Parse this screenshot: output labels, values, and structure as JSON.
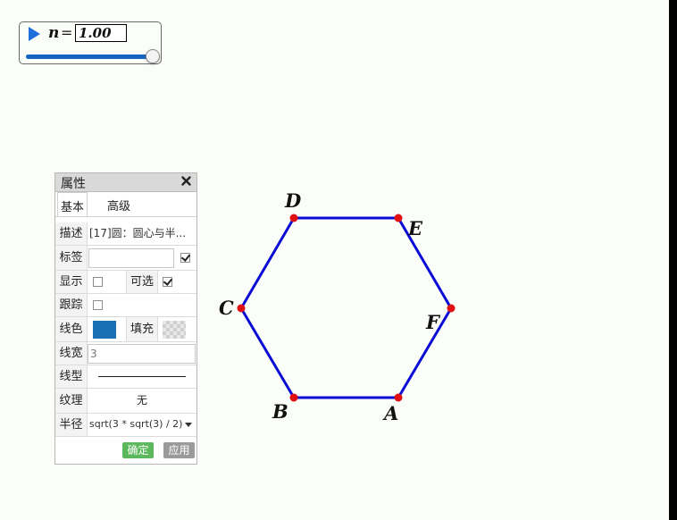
{
  "slider": {
    "var_name": "n",
    "equals": "=",
    "value": "1.00",
    "progress": 1.0,
    "track_color": "#1565c0"
  },
  "panel": {
    "title": "属性",
    "tabs": [
      "基本",
      "高级"
    ],
    "rows": {
      "description": {
        "label": "描述",
        "value": "[17]圆：圆心与半..."
      },
      "caption": {
        "label": "标签",
        "value": "",
        "checked": true
      },
      "show": {
        "label": "显示",
        "checked": false,
        "selectable_label": "可选",
        "selectable_checked": true
      },
      "trace": {
        "label": "跟踪",
        "checked": false
      },
      "color": {
        "label": "线色",
        "swatch": "#1a6fb5",
        "fill_label": "填充"
      },
      "width": {
        "label": "线宽",
        "value": "3"
      },
      "style": {
        "label": "线型"
      },
      "texture": {
        "label": "纹理",
        "value": "无"
      },
      "radius": {
        "label": "半径",
        "value": "sqrt(3 * sqrt(3) / 2)"
      }
    },
    "buttons": {
      "ok": "确定",
      "apply": "应用"
    }
  },
  "hexagon": {
    "stroke_color": "#0b0bd6",
    "point_color": "#e01010",
    "points": [
      {
        "name": "A",
        "label": "A"
      },
      {
        "name": "B",
        "label": "B"
      },
      {
        "name": "C",
        "label": "C"
      },
      {
        "name": "D",
        "label": "D"
      },
      {
        "name": "E",
        "label": "E"
      },
      {
        "name": "F",
        "label": "F"
      }
    ]
  }
}
